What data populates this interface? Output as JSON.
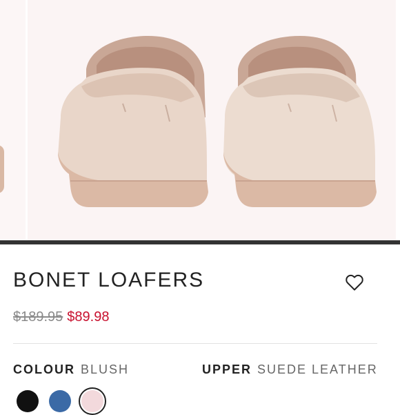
{
  "product": {
    "title": "BONET LOAFERS",
    "original_price": "$189.95",
    "sale_price": "$89.98"
  },
  "attributes": {
    "colour_label": "COLOUR",
    "colour_value": "BLUSH",
    "upper_label": "UPPER",
    "upper_value": "SUEDE LEATHER"
  },
  "swatches": [
    {
      "name": "black",
      "color": "#111111",
      "selected": false
    },
    {
      "name": "blue",
      "color": "#3b6aa6",
      "selected": false
    },
    {
      "name": "blush",
      "color": "#f3d9dc",
      "selected": true
    }
  ],
  "icons": {
    "wishlist": "heart-outline-icon"
  },
  "colors": {
    "sale": "#c8102e",
    "shoe_suede": "#e8d3c5",
    "shoe_sole": "#d7b5a3"
  }
}
